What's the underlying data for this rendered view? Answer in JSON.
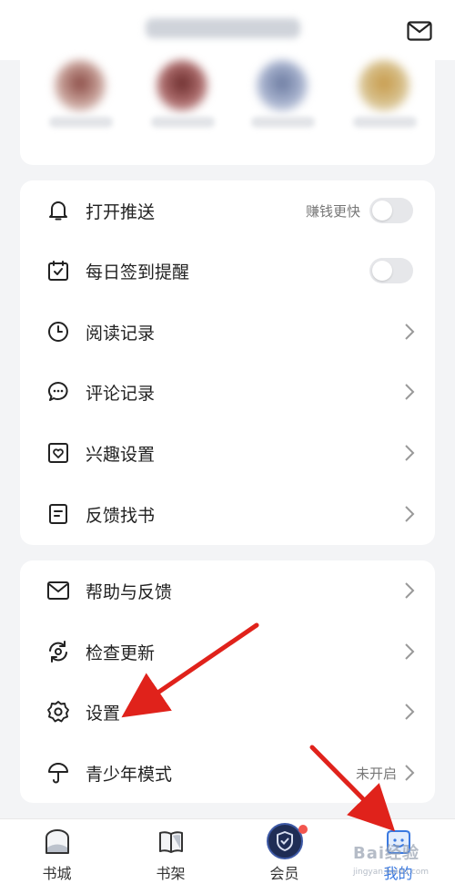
{
  "header": {
    "mail_icon": "mail-icon"
  },
  "push_section": {
    "items": [
      {
        "label": "打开推送",
        "icon": "bell-icon",
        "hint": "赚钱更快",
        "control": "toggle",
        "toggled": false
      },
      {
        "label": "每日签到提醒",
        "icon": "calendar-check-icon",
        "control": "toggle",
        "toggled": false
      },
      {
        "label": "阅读记录",
        "icon": "clock-icon",
        "control": "chevron"
      },
      {
        "label": "评论记录",
        "icon": "comment-icon",
        "control": "chevron"
      },
      {
        "label": "兴趣设置",
        "icon": "heart-square-icon",
        "control": "chevron"
      },
      {
        "label": "反馈找书",
        "icon": "document-icon",
        "control": "chevron"
      }
    ]
  },
  "settings_section": {
    "items": [
      {
        "label": "帮助与反馈",
        "icon": "mail-icon",
        "control": "chevron"
      },
      {
        "label": "检查更新",
        "icon": "refresh-icon",
        "control": "chevron"
      },
      {
        "label": "设置",
        "icon": "gear-icon",
        "control": "chevron"
      },
      {
        "label": "青少年模式",
        "icon": "umbrella-icon",
        "hint": "未开启",
        "control": "chevron"
      }
    ]
  },
  "tabbar": {
    "tabs": [
      {
        "label": "书城",
        "icon": "bookstore-icon",
        "active": false
      },
      {
        "label": "书架",
        "icon": "bookshelf-icon",
        "active": false
      },
      {
        "label": "会员",
        "icon": "vip-shield-icon",
        "active": false,
        "badge_dot": true
      },
      {
        "label": "我的",
        "icon": "profile-icon",
        "active": true
      }
    ]
  },
  "watermark": {
    "text": "Bai经验",
    "sub": "jingyan.baidu.com"
  },
  "colors": {
    "accent": "#3a79e0",
    "annotation_arrow": "#e0221b",
    "badge_dot": "#f2554e"
  }
}
